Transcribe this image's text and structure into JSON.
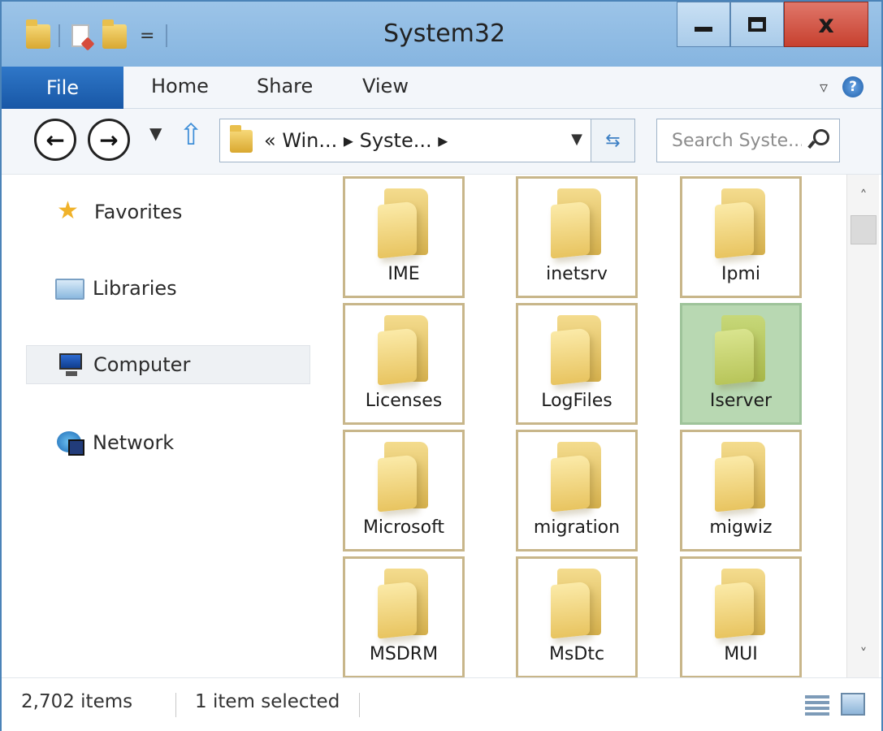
{
  "window": {
    "title": "System32"
  },
  "title_buttons": {
    "minimize": "",
    "maximize": "",
    "close": "x"
  },
  "ribbon": {
    "tabs": [
      "File",
      "Home",
      "Share",
      "View"
    ]
  },
  "navigation": {
    "address": "« Win... ▸ Syste... ▸",
    "search_placeholder": "Search Syste..."
  },
  "nav_pane": {
    "items": [
      "Favorites",
      "Libraries",
      "Computer",
      "Network"
    ],
    "selected": "Computer"
  },
  "folders": [
    {
      "name": "IME",
      "selected": false
    },
    {
      "name": "inetsrv",
      "selected": false
    },
    {
      "name": "Ipmi",
      "selected": false
    },
    {
      "name": "Licenses",
      "selected": false
    },
    {
      "name": "LogFiles",
      "selected": false
    },
    {
      "name": "Iserver",
      "selected": true
    },
    {
      "name": "Microsoft",
      "selected": false
    },
    {
      "name": "migration",
      "selected": false
    },
    {
      "name": "migwiz",
      "selected": false
    },
    {
      "name": "MSDRM",
      "selected": false
    },
    {
      "name": "MsDtc",
      "selected": false
    },
    {
      "name": "MUI",
      "selected": false
    }
  ],
  "status": {
    "item_count": "2,702 items",
    "selection": "1 item selected"
  },
  "colors": {
    "titlebar": "#9cc4e8",
    "file_tab": "#1857a6",
    "close_button": "#c7412f",
    "selected_tile": "#b8d8b2",
    "tile_border": "#c8b68a"
  }
}
